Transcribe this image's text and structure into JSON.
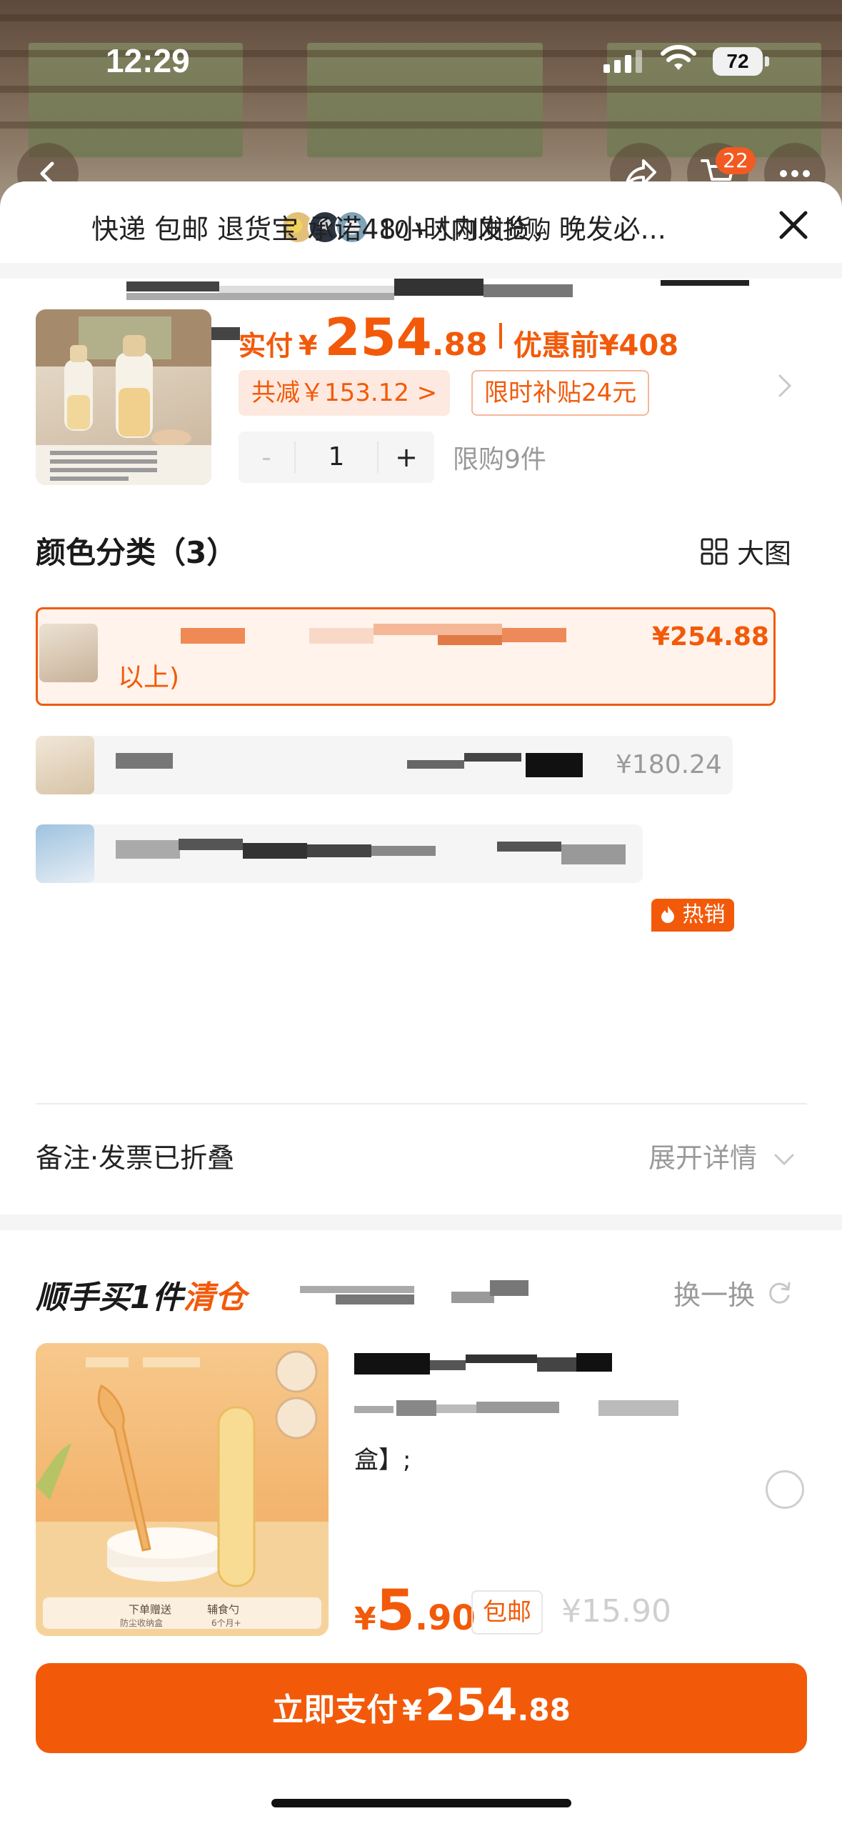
{
  "status_bar": {
    "time": "12:29",
    "battery": "72"
  },
  "top_nav": {
    "cart_badge": "22"
  },
  "sheet_header": {
    "recent_buyers": "10+人刚刚抢购"
  },
  "delivery_info": "快递 包邮 退货宝 承诺48小时内发货，晚发必...",
  "product": {
    "actual_label": "实付",
    "currency": "¥",
    "price_int": "254",
    "price_dec": ".88",
    "original_price": "优惠前¥408",
    "discount": "共减￥153.12 >",
    "subsidy": "限时补贴24元",
    "quantity": "1",
    "minus": "-",
    "plus": "+",
    "purchase_limit": "限购9件"
  },
  "color_section": {
    "title": "颜色分类（3）",
    "big_view_label": "大图",
    "options": [
      {
        "price": "¥254.88",
        "subtext": "以上)",
        "selected": true
      },
      {
        "price": "¥180.24",
        "badge": "热销",
        "selected": false
      },
      {
        "price": "",
        "selected": false
      }
    ]
  },
  "remarks": {
    "label": "备注·发票已折叠",
    "expand": "展开详情"
  },
  "upsell": {
    "title_main": "顺手买1件",
    "title_accent": "清仓",
    "swap_label": "换一换",
    "title_tail": "盒】;",
    "image_texts": [
      "下单赠送",
      "防尘收纳盒",
      "辅食勺",
      "6个月+"
    ],
    "currency": "¥",
    "price_int": "5",
    "price_dec": ".90",
    "shipping": "包邮",
    "original_price": "¥15.90"
  },
  "pay_button": {
    "label": "立即支付",
    "currency": "¥",
    "price_int": "254",
    "price_dec": ".88"
  },
  "colors": {
    "accent": "#f25a0a",
    "accent_light": "#fde9df",
    "muted": "#9a9a9a"
  }
}
